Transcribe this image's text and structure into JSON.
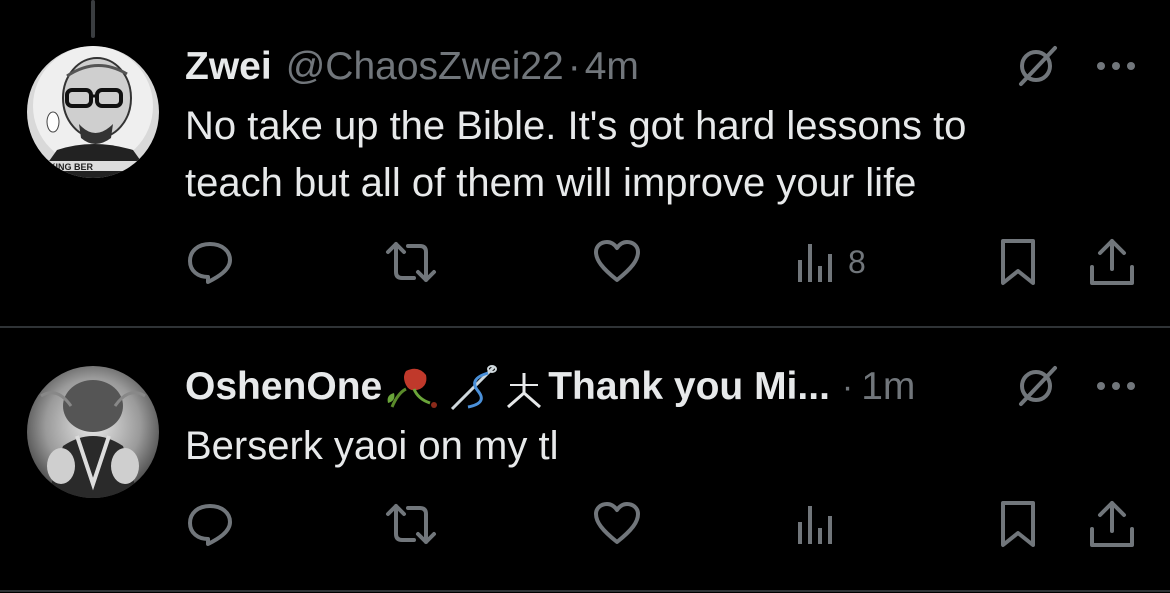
{
  "tweets": [
    {
      "display_name": "Zwei",
      "handle": "@ChaosZwei22",
      "separator": "·",
      "time": "4m",
      "text_lines": [
        "No take up the Bible. It's got hard lessons to",
        "teach but all of them will improve your life"
      ],
      "actions": {
        "reply": "reply-icon",
        "repost": "repost-icon",
        "like": "heart-icon",
        "views_count": "8",
        "bookmark": "bookmark-icon",
        "share": "share-icon"
      },
      "avatar_banner_text": "KING BER"
    },
    {
      "display_name_prefix": "OshenOne",
      "display_name_suffix": "Thank you Mi...",
      "name_emojis": [
        "wilted-rose-emoji",
        "thread-needle-emoji",
        "person-symbol-emoji"
      ],
      "separator": "·",
      "time": "1m",
      "text_lines": [
        "Berserk yaoi on my tl"
      ],
      "actions": {
        "reply": "reply-icon",
        "repost": "repost-icon",
        "like": "heart-icon",
        "views_count": "",
        "bookmark": "bookmark-icon",
        "share": "share-icon"
      }
    }
  ],
  "colors": {
    "background": "#000000",
    "primary_text": "#e7e9ea",
    "secondary_text": "#71767b",
    "divider": "#2f3336"
  }
}
